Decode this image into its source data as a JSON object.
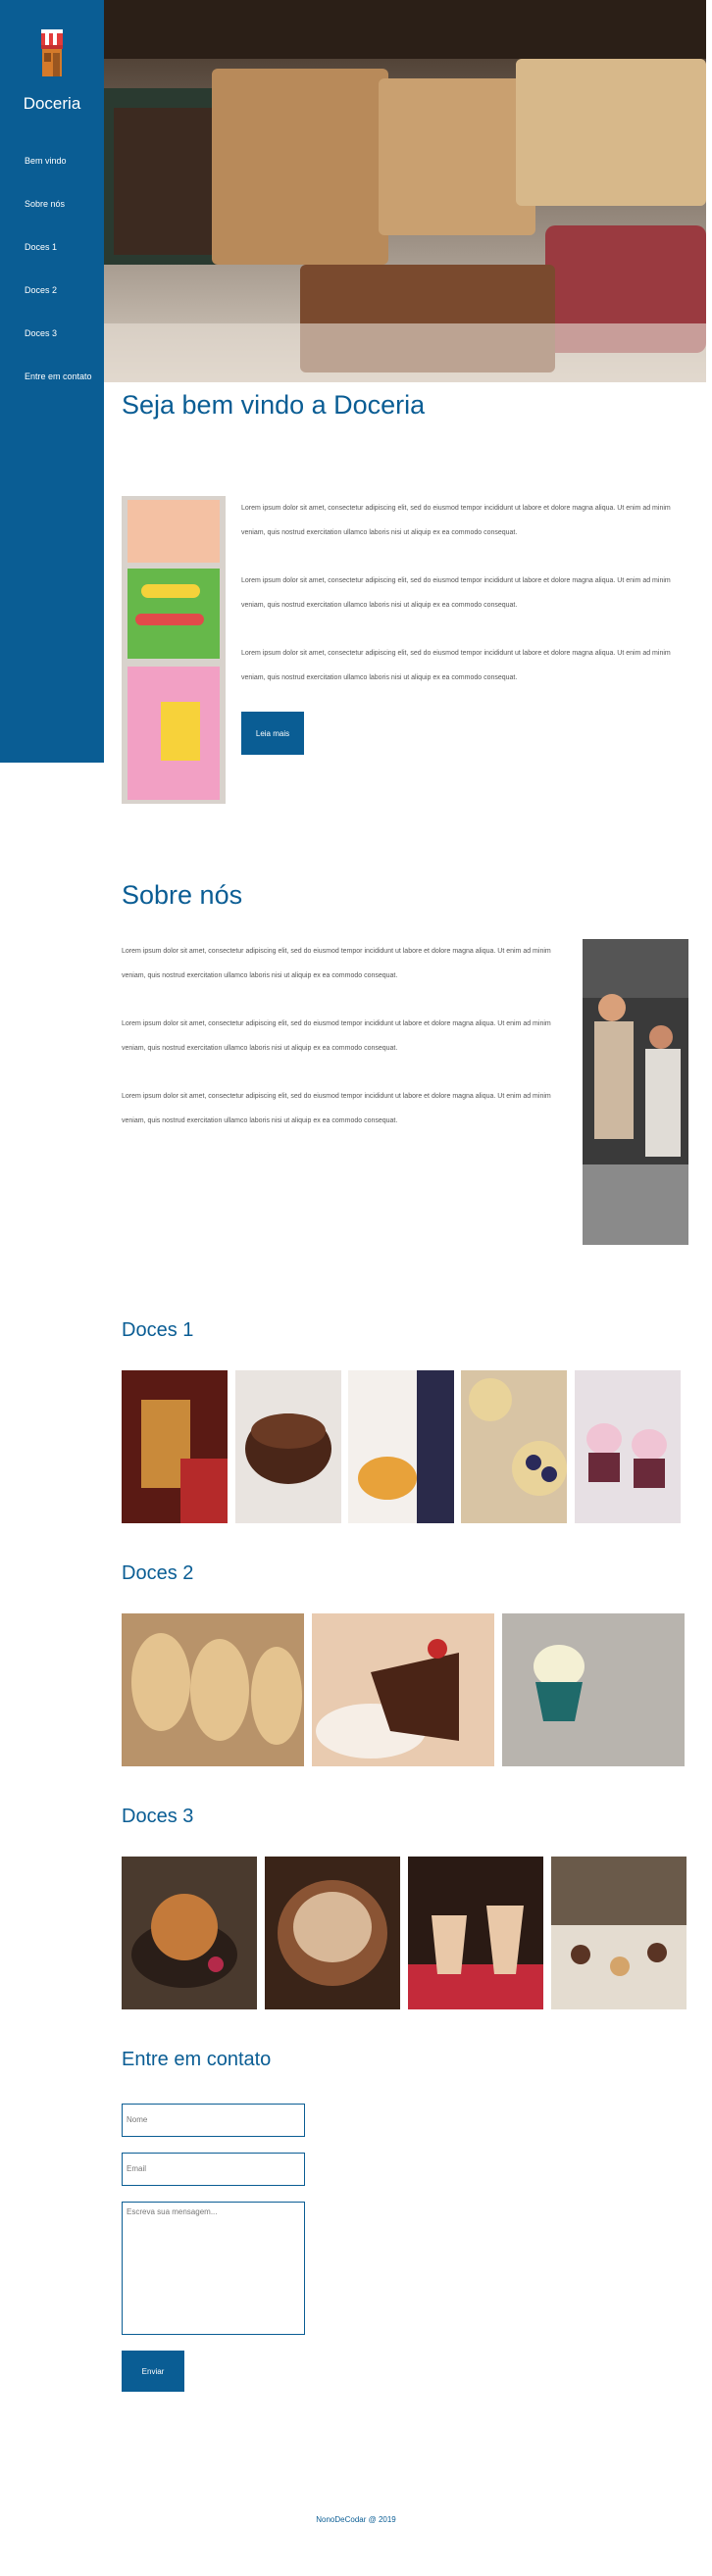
{
  "brand": {
    "name": "Doceria",
    "logo_icon": "shop-awning-icon"
  },
  "nav": {
    "items": [
      "Bem vindo",
      "Sobre nós",
      "Doces 1",
      "Doces 2",
      "Doces 3",
      "Entre em contato"
    ]
  },
  "welcome": {
    "title": "Seja bem vindo a Doceria",
    "paragraphs": [
      "Lorem ipsum dolor sit amet, consectetur adipiscing elit, sed do eiusmod tempor incididunt ut labore et dolore magna aliqua. Ut enim ad minim veniam, quis nostrud exercitation ullamco laboris nisi ut aliquip ex ea commodo consequat.",
      "Lorem ipsum dolor sit amet, consectetur adipiscing elit, sed do eiusmod tempor incididunt ut labore et dolore magna aliqua. Ut enim ad minim veniam, quis nostrud exercitation ullamco laboris nisi ut aliquip ex ea commodo consequat.",
      "Lorem ipsum dolor sit amet, consectetur adipiscing elit, sed do eiusmod tempor incididunt ut labore et dolore magna aliqua. Ut enim ad minim veniam, quis nostrud exercitation ullamco laboris nisi ut aliquip ex ea commodo consequat."
    ],
    "button_label": "Leia mais"
  },
  "about": {
    "title": "Sobre nós",
    "paragraphs": [
      "Lorem ipsum dolor sit amet, consectetur adipiscing elit, sed do eiusmod tempor incididunt ut labore et dolore magna aliqua. Ut enim ad minim veniam, quis nostrud exercitation ullamco laboris nisi ut aliquip ex ea commodo consequat.",
      "Lorem ipsum dolor sit amet, consectetur adipiscing elit, sed do eiusmod tempor incididunt ut labore et dolore magna aliqua. Ut enim ad minim veniam, quis nostrud exercitation ullamco laboris nisi ut aliquip ex ea commodo consequat.",
      "Lorem ipsum dolor sit amet, consectetur adipiscing elit, sed do eiusmod tempor incididunt ut labore et dolore magna aliqua. Ut enim ad minim veniam, quis nostrud exercitation ullamco laboris nisi ut aliquip ex ea commodo consequat."
    ]
  },
  "galleries": [
    {
      "title": "Doces 1"
    },
    {
      "title": "Doces 2"
    },
    {
      "title": "Doces 3"
    }
  ],
  "contact": {
    "title": "Entre em contato",
    "name_placeholder": "Nome",
    "email_placeholder": "Email",
    "message_placeholder": "Escreva sua mensagem...",
    "submit_label": "Enviar"
  },
  "footer": {
    "text": "NonoDeCodar @ 2019"
  },
  "colors": {
    "primary": "#0a5d94",
    "background": "#ffffff",
    "text": "#555555"
  }
}
